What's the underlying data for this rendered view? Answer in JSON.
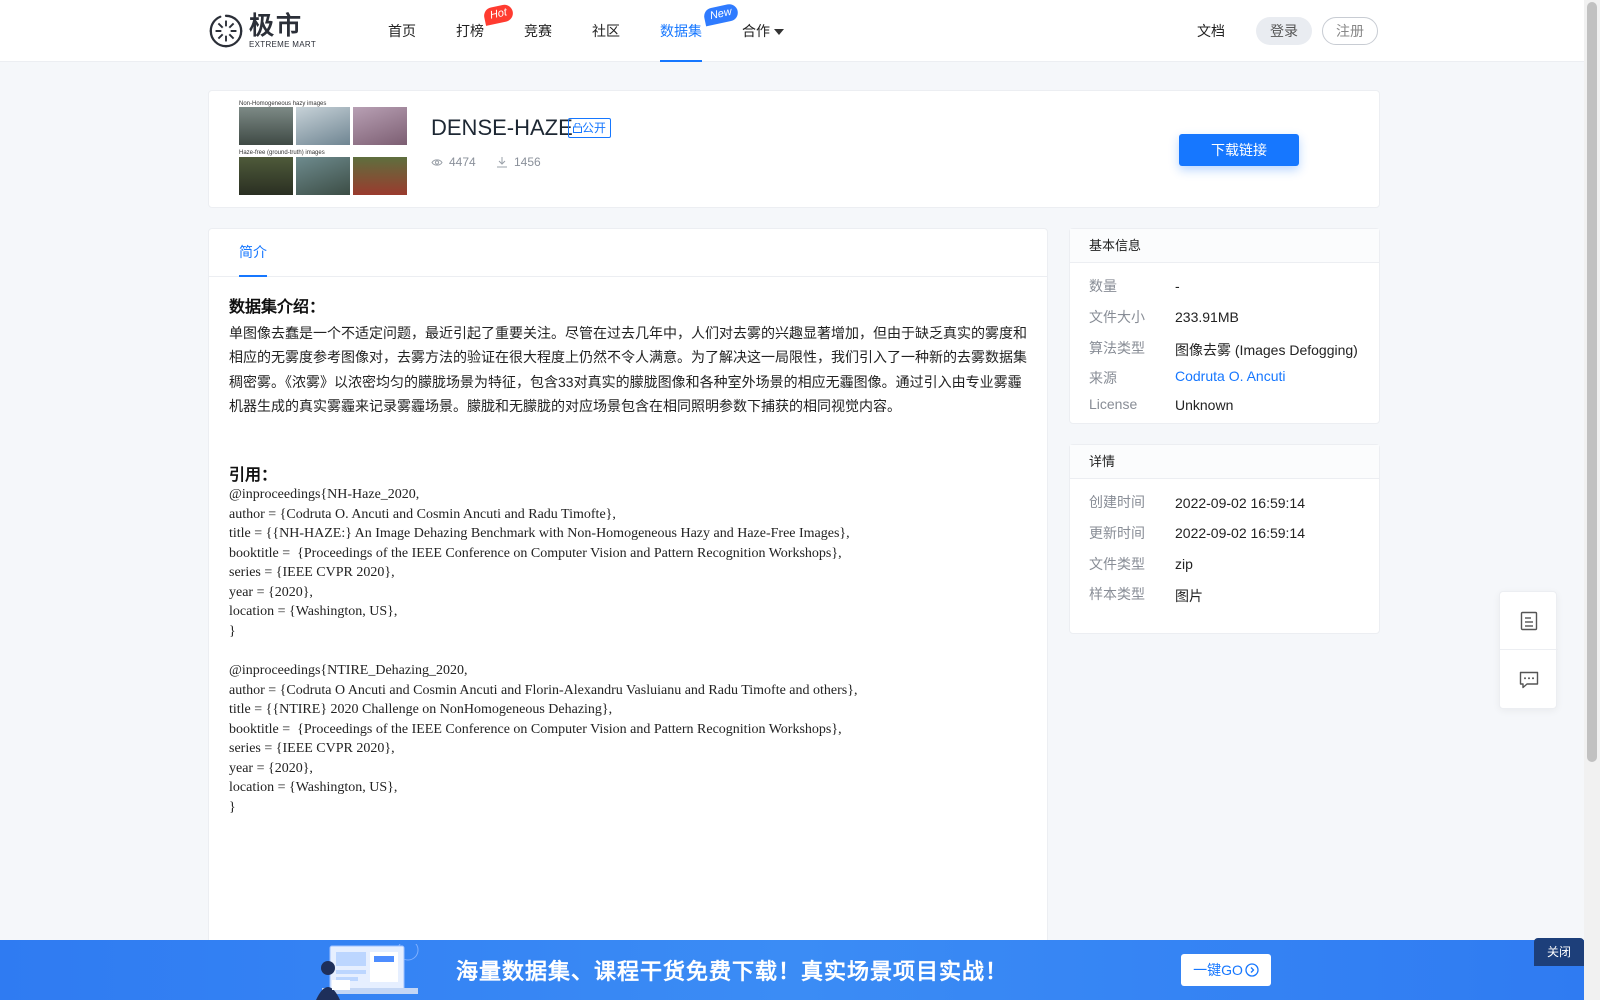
{
  "header": {
    "logo_cn": "极市",
    "logo_en": "EXTREME MART",
    "nav": [
      {
        "label": "首页"
      },
      {
        "label": "打榜",
        "badge": "Hot"
      },
      {
        "label": "竞赛"
      },
      {
        "label": "社区"
      },
      {
        "label": "数据集",
        "badge": "New",
        "active": true
      },
      {
        "label": "合作"
      }
    ],
    "docs": "文档",
    "login": "登录",
    "register": "注册"
  },
  "dataset": {
    "title": "DENSE-HAZE",
    "public_tag": "公开",
    "views": "4474",
    "downloads": "1456",
    "download_button": "下载链接",
    "thumb_caption_top": "Non-Homogeneous hazy images",
    "thumb_caption_bottom": "Haze-free (ground-truth) images"
  },
  "tabs": [
    {
      "label": "简介"
    }
  ],
  "intro": {
    "heading": "数据集介绍：",
    "body": "单图像去蠢是一个不适定问题，最近引起了重要关注。尽管在过去几年中，人们对去雾的兴趣显著增加，但由于缺乏真实的雾度和相应的无雾度参考图像对，去雾方法的验证在很大程度上仍然不令人满意。为了解决这一局限性，我们引入了一种新的去雾数据集稠密雾。《浓雾》以浓密均匀的朦胧场景为特征，包含33对真实的朦胧图像和各种室外场景的相应无霾图像。通过引入由专业雾霾机器生成的真实雾霾来记录雾霾场景。朦胧和无朦胧的对应场景包含在相同照明参数下捕获的相同视觉内容。"
  },
  "citation": {
    "heading": "引用：",
    "block1": "@inproceedings{NH-Haze_2020,\nauthor = {Codruta O. Ancuti and Cosmin Ancuti and Radu Timofte},\ntitle = {{NH-HAZE:} An Image Dehazing Benchmark with Non-Homogeneous Hazy and Haze-Free Images},\nbooktitle =  {Proceedings of the IEEE Conference on Computer Vision and Pattern Recognition Workshops},\nseries = {IEEE CVPR 2020},\nyear = {2020},\nlocation = {Washington, US},\n}",
    "block2": "@inproceedings{NTIRE_Dehazing_2020,\nauthor = {Codruta O Ancuti and Cosmin Ancuti and Florin-Alexandru Vasluianu and Radu Timofte and others},\ntitle = {{NTIRE} 2020 Challenge on NonHomogeneous Dehazing},\nbooktitle =  {Proceedings of the IEEE Conference on Computer Vision and Pattern Recognition Workshops},\nseries = {IEEE CVPR 2020},\nyear = {2020},\nlocation = {Washington, US},\n}"
  },
  "basic_info": {
    "heading": "基本信息",
    "rows": [
      {
        "label": "数量",
        "value": "-"
      },
      {
        "label": "文件大小",
        "value": "233.91MB"
      },
      {
        "label": "算法类型",
        "value": "图像去雾 (Images Defogging)"
      },
      {
        "label": "来源",
        "value": "Codruta O. Ancuti"
      },
      {
        "label": "License",
        "value": "Unknown"
      }
    ]
  },
  "details": {
    "heading": "详情",
    "rows": [
      {
        "label": "创建时间",
        "value": "2022-09-02 16:59:14"
      },
      {
        "label": "更新时间",
        "value": "2022-09-02 16:59:14"
      },
      {
        "label": "文件类型",
        "value": "zip"
      },
      {
        "label": "样本类型",
        "value": "图片"
      }
    ]
  },
  "banner": {
    "text": "海量数据集、课程干货免费下载！真实场景项目实战！",
    "go_button": "一键GO",
    "close": "关闭"
  },
  "colors": {
    "accent": "#1677ff",
    "hot_badge": "#ff3b30",
    "banner": "#2f7bf2"
  }
}
